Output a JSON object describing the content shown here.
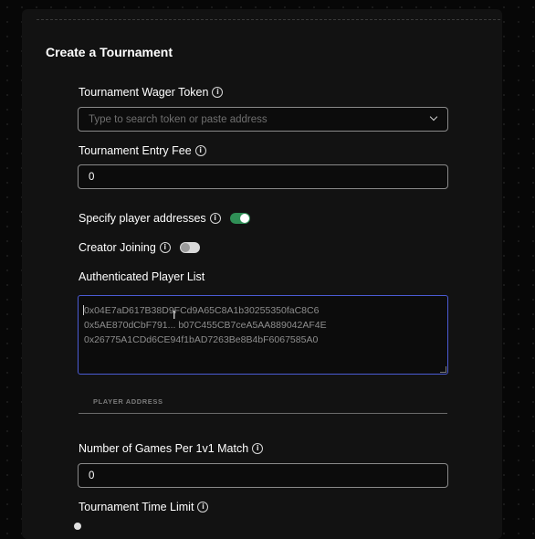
{
  "form": {
    "title": "Create a Tournament",
    "wager_token": {
      "label": "Tournament Wager Token",
      "placeholder": "Type to search token or paste address",
      "value": ""
    },
    "entry_fee": {
      "label": "Tournament Entry Fee",
      "value": "0"
    },
    "specify_players": {
      "label": "Specify player addresses",
      "enabled": true
    },
    "creator_joining": {
      "label": "Creator Joining",
      "enabled": false
    },
    "player_list": {
      "label": "Authenticated Player List",
      "lines": [
        "0x04E7aD617B38D9FCd9A65C8A1b30255350faC8C6",
        "0x5AE870dCbF791... b07C455CB7ceA5AA889042AF4E",
        "0x26775A1CDd6CE94f1bAD7263Be8B4bF6067585A0"
      ]
    },
    "player_table": {
      "column_header": "PLAYER ADDRESS"
    },
    "games_per_match": {
      "label": "Number of Games Per 1v1 Match",
      "value": "0"
    },
    "time_limit": {
      "label": "Tournament Time Limit"
    }
  },
  "icons": {
    "info": "info-circle-icon",
    "dropdown": "chevron-down-icon",
    "cursor": "text-cursor-icon"
  },
  "colors": {
    "background": "#070707",
    "panel": "#121212",
    "toggle_on": "#2f8f56",
    "toggle_off": "#d9d9d9",
    "textarea_focus_border": "#4b5bd4"
  }
}
